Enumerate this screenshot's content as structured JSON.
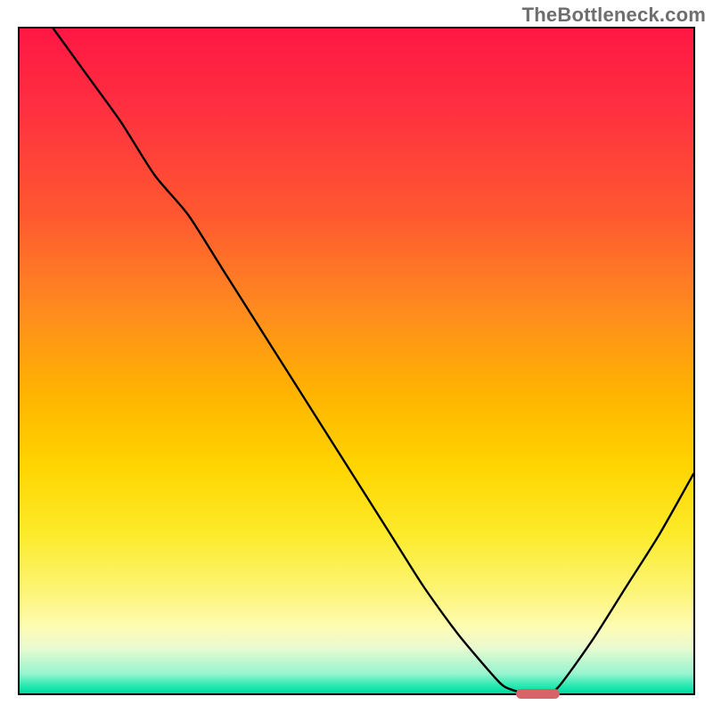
{
  "watermark": "TheBottleneck.com",
  "colors": {
    "gradient_top": "#ff1744",
    "gradient_bottom": "#00d8a0",
    "curve": "#000000",
    "marker": "#d8646a"
  },
  "chart_data": {
    "type": "line",
    "title": "",
    "xlabel": "",
    "ylabel": "",
    "xlim": [
      0,
      100
    ],
    "ylim": [
      0,
      100
    ],
    "grid": false,
    "series": [
      {
        "name": "curve",
        "x": [
          5,
          10,
          15,
          20,
          25,
          30,
          35,
          40,
          45,
          50,
          55,
          60,
          65,
          70,
          72,
          75,
          78,
          80,
          85,
          90,
          95,
          100
        ],
        "y": [
          100,
          93,
          86,
          78,
          72,
          64,
          56,
          48,
          40,
          32,
          24,
          16,
          9,
          3,
          1,
          0,
          0,
          1,
          8,
          16,
          24,
          33
        ]
      }
    ],
    "marker": {
      "x": 76.5,
      "y": 0.5,
      "width_pct": 6.5,
      "height_pct": 1.4
    },
    "annotations": [
      "TheBottleneck.com"
    ]
  }
}
